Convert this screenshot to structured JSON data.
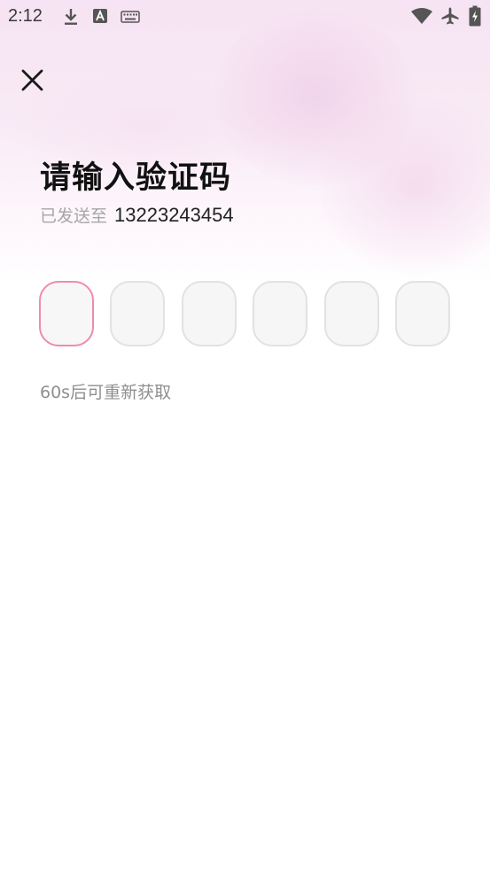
{
  "status_bar": {
    "time": "2:12",
    "left_icons": [
      "download-icon",
      "font-a-icon",
      "keyboard-icon"
    ],
    "right_icons": [
      "wifi-icon",
      "airplane-icon",
      "battery-charging-icon"
    ]
  },
  "header": {
    "close_icon": "close-icon"
  },
  "main": {
    "title": "请输入验证码",
    "sent_label": "已发送至",
    "phone_number": "13223243454",
    "code_length": 6,
    "active_box_index": 0,
    "resend_text": "60s后可重新获取"
  },
  "colors": {
    "active_border": "#f08cab",
    "box_border": "#e2e2e2",
    "box_fill": "#f6f6f6",
    "header_gradient": "#f6e3f3"
  }
}
